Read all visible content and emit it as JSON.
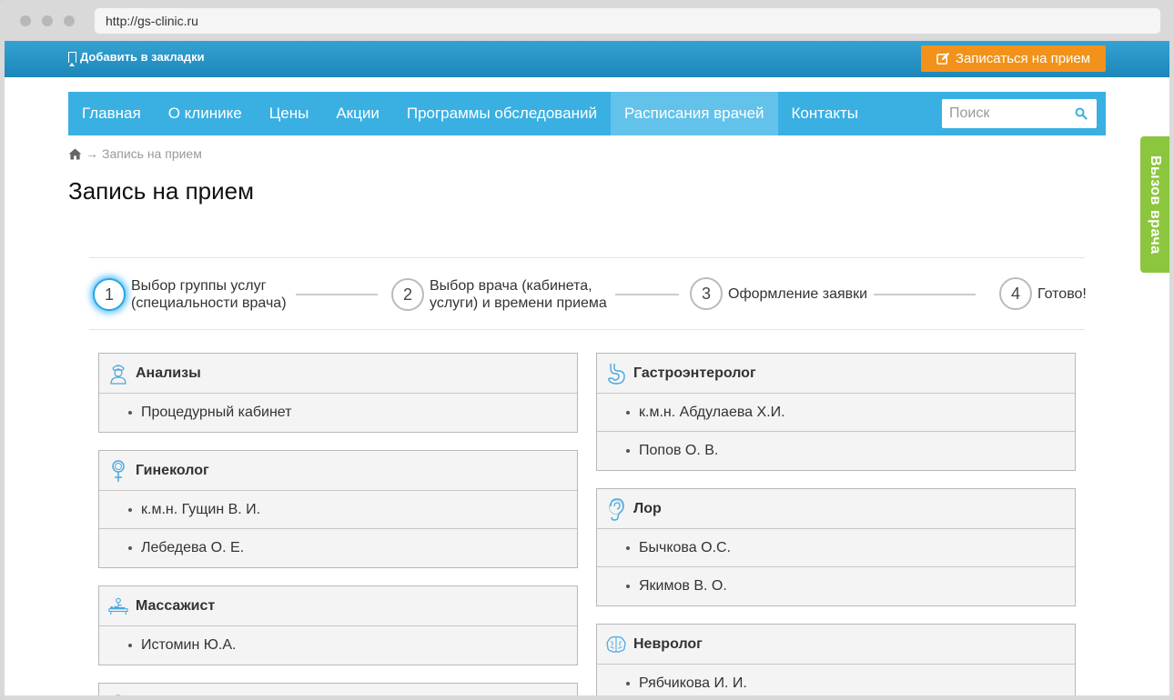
{
  "browser": {
    "url": "http://gs-clinic.ru"
  },
  "topbar": {
    "bookmark_label": "Добавить в закладки",
    "appointment_label": "Записаться на прием",
    "appointment_color": "#f2921a"
  },
  "nav": {
    "items": [
      "Главная",
      "О клинике",
      "Цены",
      "Акции",
      "Программы обследований",
      "Расписания врачей",
      "Контакты"
    ],
    "active": "Расписания врачей",
    "search_placeholder": "Поиск"
  },
  "breadcrumb": {
    "arrow": "→",
    "current": "Запись на прием"
  },
  "page_title": "Запись на прием",
  "steps": [
    {
      "num": "1",
      "line1": "Выбор группы услуг",
      "line2": "(специальности врача)",
      "active": true
    },
    {
      "num": "2",
      "line1": "Выбор врача (кабинета,",
      "line2": "услуги) и времени приема",
      "active": false
    },
    {
      "num": "3",
      "line1": "Оформление заявки",
      "line2": "",
      "active": false
    },
    {
      "num": "4",
      "line1": "Готово!",
      "line2": "",
      "active": false
    }
  ],
  "groups_left": [
    {
      "icon": "nurse-icon",
      "title": "Анализы",
      "items": [
        "Процедурный кабинет"
      ]
    },
    {
      "icon": "female-icon",
      "title": "Гинеколог",
      "items": [
        "к.м.н. Гущин В. И.",
        "Лебедева О. Е."
      ]
    },
    {
      "icon": "massage-icon",
      "title": "Массажист",
      "items": [
        "Истомин Ю.А."
      ]
    }
  ],
  "groups_right": [
    {
      "icon": "stomach-icon",
      "title": "Гастроэнтеролог",
      "items": [
        "к.м.н. Абдулаева Х.И.",
        "Попов О. В."
      ]
    },
    {
      "icon": "ear-icon",
      "title": "Лор",
      "items": [
        "Бычкова О.С.",
        "Якимов В. О."
      ]
    },
    {
      "icon": "brain-icon",
      "title": "Невролог",
      "items": [
        "Рябчикова И. И."
      ]
    }
  ],
  "side_tab": {
    "label": "Вызов врача",
    "color": "#8cc63f"
  },
  "colors": {
    "accent": "#3ab0e2",
    "topbar": "#1d86b8"
  }
}
